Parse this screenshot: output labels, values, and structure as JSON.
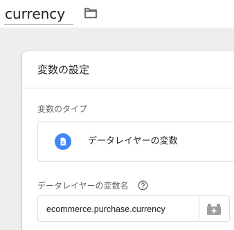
{
  "header": {
    "variable_name": "currency",
    "folder_icon": "folder-icon"
  },
  "config": {
    "title": "変数の設定",
    "type_section_label": "変数のタイプ",
    "type": {
      "icon": "document-icon",
      "icon_color": "#4285f4",
      "label": "データレイヤーの変数"
    },
    "dlv_name_label": "データレイヤーの変数名",
    "help_icon": "help-circle-icon",
    "dlv_name_value": "ecommerce.purchase.currency",
    "variable_picker_icon": "variable-brick-icon"
  }
}
